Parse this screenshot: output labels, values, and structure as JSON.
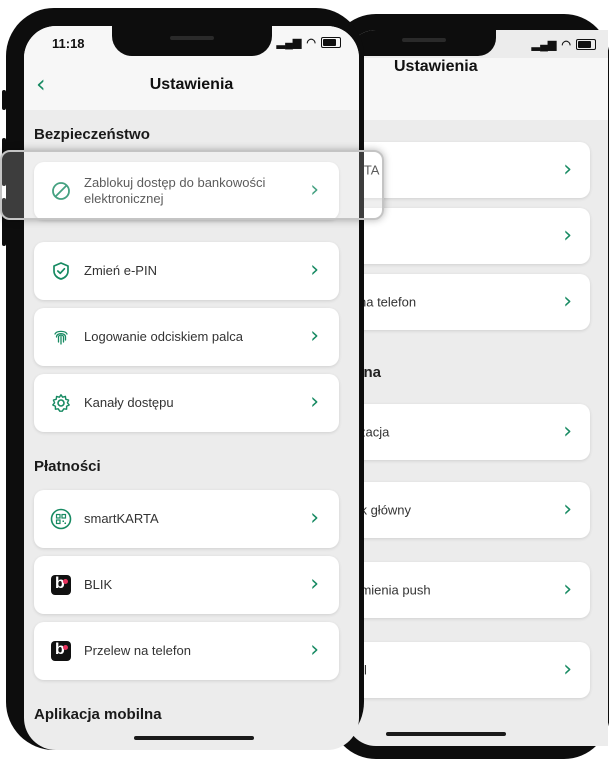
{
  "front": {
    "time": "11:18",
    "title": "Ustawienia",
    "sections": {
      "security": "Bezpieczeństwo",
      "payments": "Płatności",
      "mobile_app": "Aplikacja mobilna"
    },
    "security_items": [
      {
        "label": "Zablokuj dostęp do bankowości elektronicznej",
        "icon": "block-icon"
      },
      {
        "label": "Zmień e-PIN",
        "icon": "shield-check-icon"
      },
      {
        "label": "Logowanie odciskiem palca",
        "icon": "fingerprint-icon"
      },
      {
        "label": "Kanały dostępu",
        "icon": "gear-icon"
      }
    ],
    "payment_items": [
      {
        "label": "smartKARTA",
        "icon": "smartkarta-icon"
      },
      {
        "label": "BLIK",
        "icon": "blik-icon"
      },
      {
        "label": "Przelew na telefon",
        "icon": "blik-icon"
      }
    ]
  },
  "back": {
    "title": "Ustawienia",
    "items": [
      {
        "label": "ARTA"
      },
      {
        "label": ""
      },
      {
        "label": "w na telefon"
      },
      {
        "label": "alizacja"
      },
      {
        "label": "nek główny"
      },
      {
        "label": "domienia push"
      },
      {
        "label": "rofil"
      }
    ],
    "section_label": "bilna"
  },
  "colors": {
    "accent": "#178a62",
    "background": "#ececec",
    "card": "#ffffff",
    "blik_dot": "#e8335e"
  }
}
